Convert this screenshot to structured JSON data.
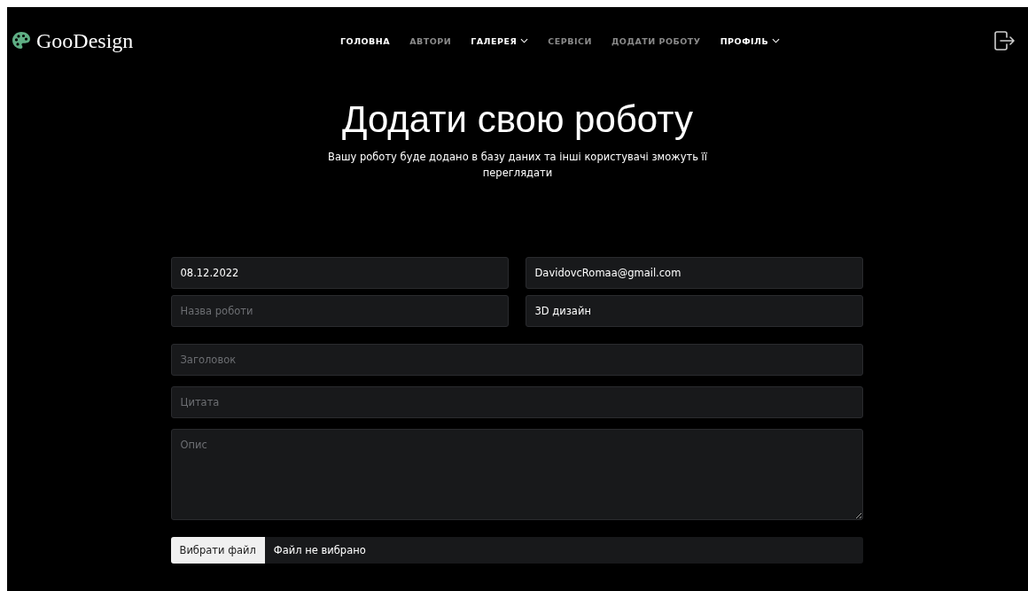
{
  "logo": {
    "text": "GooDesign"
  },
  "nav": [
    {
      "label": "ГОЛОВНА",
      "selected": true,
      "dropdown": false
    },
    {
      "label": "АВТОРИ",
      "selected": false,
      "dropdown": false
    },
    {
      "label": "ГАЛЕРЕЯ",
      "selected": true,
      "dropdown": true
    },
    {
      "label": "СЕРВІСИ",
      "selected": false,
      "dropdown": false
    },
    {
      "label": "ДОДАТИ РОБОТУ",
      "selected": false,
      "dropdown": false
    },
    {
      "label": "ПРОФІЛЬ",
      "selected": true,
      "dropdown": true
    }
  ],
  "heading": "Додати свою роботу",
  "subtitle": "Вашу роботу буде додано в базу даних та інші користувачі зможуть її переглядати",
  "form": {
    "row_1": [
      {
        "value": "08.12.2022"
      },
      {
        "value": "DavidovcRomaa@gmail.com"
      }
    ],
    "row_2": [
      {
        "placeholder": "Назва роботи"
      },
      {
        "value": "3D дизайн"
      }
    ],
    "title_field": {
      "placeholder": "Заголовок"
    },
    "quote_field": {
      "placeholder": "Цитата"
    },
    "description": {
      "placeholder": "Опис"
    },
    "file": {
      "button": "Вибрати файл",
      "status": "Файл не вибрано"
    }
  }
}
